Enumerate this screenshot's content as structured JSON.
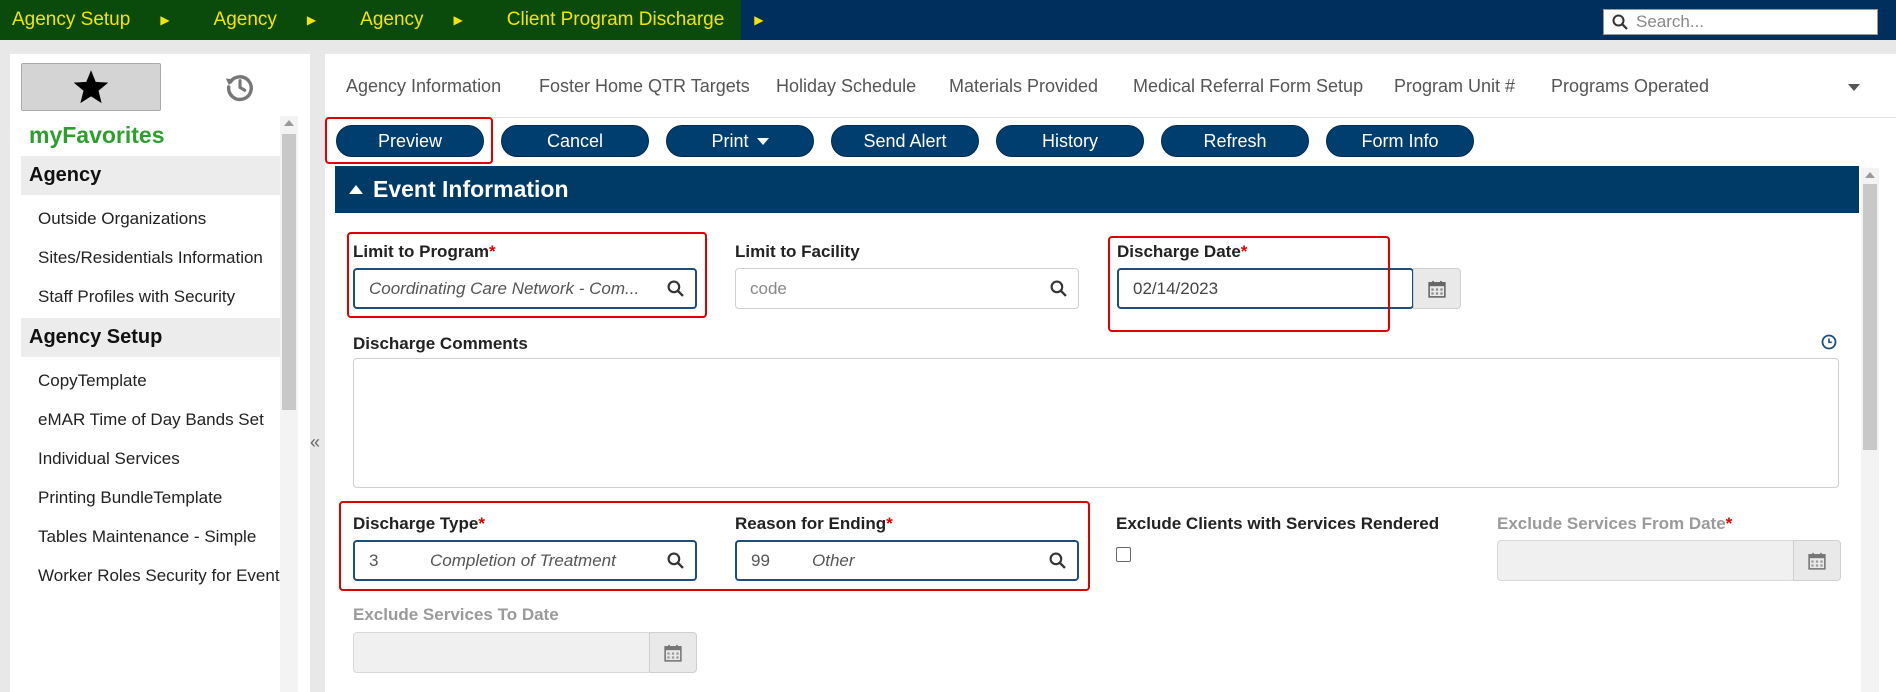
{
  "breadcrumb": [
    "Agency Setup",
    "Agency",
    "Agency",
    "Client Program Discharge"
  ],
  "search": {
    "placeholder": "Search..."
  },
  "left": {
    "favorites_title": "myFavorites",
    "groups": [
      {
        "header": "Agency",
        "items": [
          "Outside Organizations",
          "Sites/Residentials Information",
          "Staff Profiles with Security"
        ]
      },
      {
        "header": "Agency Setup",
        "items": [
          "CopyTemplate",
          "eMAR Time of Day Bands Set",
          "Individual Services",
          "Printing BundleTemplate",
          "Tables Maintenance - Simple",
          "Worker Roles Security for Events"
        ]
      }
    ],
    "collapse_glyph": "«"
  },
  "tabs": [
    "Agency Information",
    "Foster Home QTR Targets",
    "Holiday Schedule",
    "Materials Provided",
    "Medical Referral Form Setup",
    "Program Unit #",
    "Programs Operated"
  ],
  "buttons": {
    "preview": "Preview",
    "cancel": "Cancel",
    "print": "Print",
    "send_alert": "Send Alert",
    "history": "History",
    "refresh": "Refresh",
    "form_info": "Form Info"
  },
  "section": {
    "title": "Event Information"
  },
  "form": {
    "limit_program": {
      "label": "Limit to Program",
      "required": "*",
      "value": "Coordinating Care Network - Com..."
    },
    "limit_facility": {
      "label": "Limit to Facility",
      "placeholder": "code"
    },
    "discharge_date": {
      "label": "Discharge Date",
      "required": "*",
      "value": "02/14/2023"
    },
    "discharge_comments": {
      "label": "Discharge Comments"
    },
    "discharge_type": {
      "label": "Discharge Type",
      "required": "*",
      "code": "3",
      "desc": "Completion of Treatment"
    },
    "reason_ending": {
      "label": "Reason for Ending",
      "required": "*",
      "code": "99",
      "desc": "Other"
    },
    "exclude_clients": {
      "label": "Exclude Clients with Services Rendered"
    },
    "exclude_from": {
      "label": "Exclude Services From Date",
      "required": "*"
    },
    "exclude_to": {
      "label": "Exclude Services To Date"
    }
  },
  "colors": {
    "nav_bg": "#002e5d",
    "breadcrumb_bg": "#0a4a0a",
    "breadcrumb_text": "#f5e400",
    "button_bg": "#003e6f",
    "favorites": "#2ca02c",
    "required": "#e00000",
    "highlight": "#e00000"
  }
}
